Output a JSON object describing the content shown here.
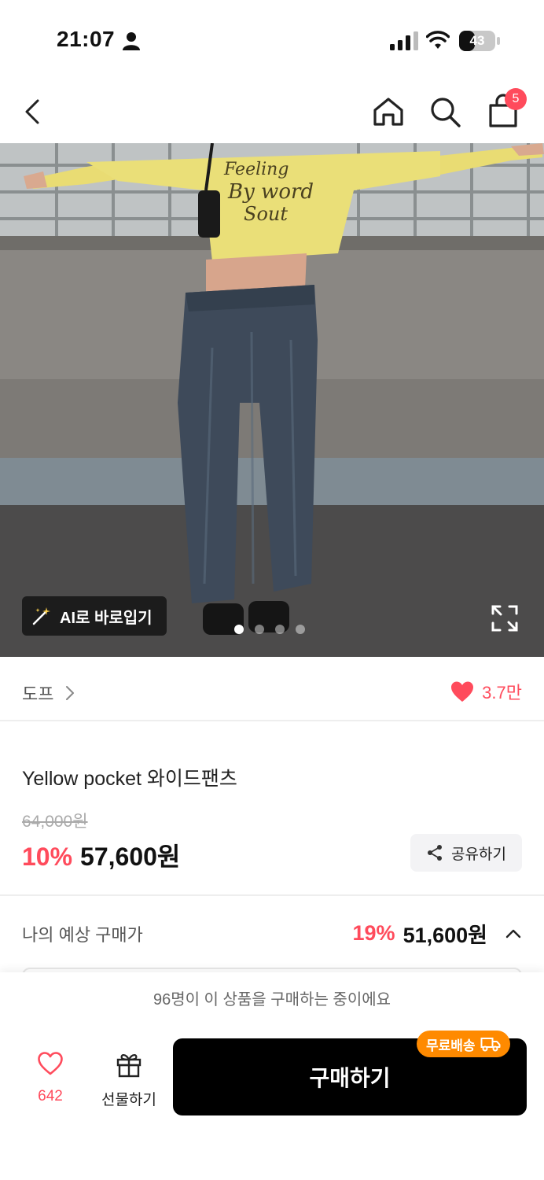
{
  "status_bar": {
    "time": "21:07",
    "battery": "43"
  },
  "nav": {
    "cart_count": "5"
  },
  "hero": {
    "ai_label": "AI로 바로입기",
    "page_total": 4,
    "page_current": 1
  },
  "brand": {
    "name": "도프",
    "likes": "3.7만"
  },
  "product": {
    "title": "Yellow pocket 와이드팬츠",
    "original_price": "64,000원",
    "discount": "10%",
    "price": "57,600원",
    "share_label": "공유하기"
  },
  "expected": {
    "label": "나의 예상 구매가",
    "discount": "19%",
    "price": "51,600원"
  },
  "bottom": {
    "buyers_text": "96명이 이 상품을 구매하는 중이에요",
    "wish_count": "642",
    "gift_label": "선물하기",
    "buy_label": "구매하기",
    "free_ship_label": "무료배송"
  },
  "colors": {
    "accent": "#ff4b5c",
    "ship_badge": "#ff8a00",
    "buy_button": "#000000"
  }
}
